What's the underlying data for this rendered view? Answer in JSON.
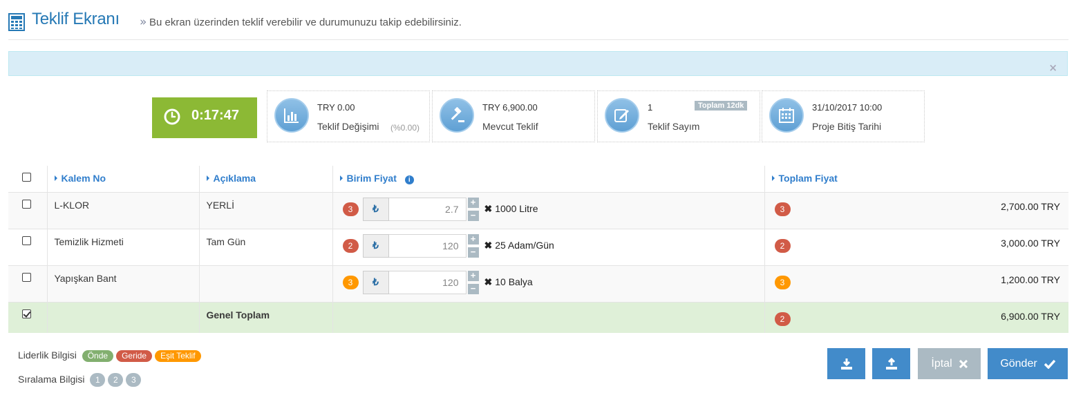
{
  "header": {
    "title": "Teklif Ekranı",
    "separator": "»",
    "subtitle": "Bu ekran üzerinden teklif verebilir ve durumunuzu takip edebilirsiniz."
  },
  "alert": {
    "close": "×"
  },
  "timer": {
    "value": "0:17:47"
  },
  "stats": [
    {
      "icon": "bar-chart-icon",
      "line1": "TRY 0.00",
      "line2": "Teklif Değişimi",
      "extra": "(%0.00)"
    },
    {
      "icon": "gavel-icon",
      "line1": "TRY 6,900.00",
      "line2": "Mevcut Teklif"
    },
    {
      "icon": "edit-icon",
      "line1": "1",
      "line2": "Teklif Sayım",
      "tag": "Toplam 12dk"
    },
    {
      "icon": "calendar-icon",
      "line1": "31/10/2017 10:00",
      "line2": "Proje Bitiş Tarihi"
    }
  ],
  "table": {
    "headers": {
      "item_no": "Kalem No",
      "description": "Açıklama",
      "unit_price": "Birim Fiyat",
      "total_price": "Toplam Fiyat"
    },
    "rows": [
      {
        "item_no": "L-KLOR",
        "description": "YERLİ",
        "rank": "3",
        "rank_color": "#d15b47",
        "currency": "₺",
        "price": "2.7",
        "unit_mult": "✖",
        "unit": "1000 Litre",
        "total_rank": "3",
        "total_rank_color": "#d15b47",
        "total": "2,700.00 TRY",
        "checked": false
      },
      {
        "item_no": "Temizlik Hizmeti",
        "description": "Tam Gün",
        "rank": "2",
        "rank_color": "#d15b47",
        "currency": "₺",
        "price": "120",
        "unit_mult": "✖",
        "unit": "25 Adam/Gün",
        "total_rank": "2",
        "total_rank_color": "#d15b47",
        "total": "3,000.00 TRY",
        "checked": false
      },
      {
        "item_no": "Yapışkan Bant",
        "description": "",
        "rank": "3",
        "rank_color": "#ff9800",
        "currency": "₺",
        "price": "120",
        "unit_mult": "✖",
        "unit": "10 Balya",
        "total_rank": "3",
        "total_rank_color": "#ff9800",
        "total": "1,200.00 TRY",
        "checked": false
      }
    ],
    "grand_total": {
      "label": "Genel Toplam",
      "rank": "2",
      "rank_color": "#d15b47",
      "total": "6,900.00 TRY",
      "checked": true
    }
  },
  "legend": {
    "leadership_label": "Liderlik Bilgisi",
    "leadership": [
      {
        "text": "Önde",
        "color": "#82af6f"
      },
      {
        "text": "Geride",
        "color": "#d15b47"
      },
      {
        "text": "Eşit Teklif",
        "color": "#ff9800"
      }
    ],
    "ranking_label": "Sıralama Bilgisi",
    "ranking": [
      "1",
      "2",
      "3"
    ]
  },
  "buttons": {
    "download": "download-icon",
    "upload": "upload-icon",
    "cancel": "İptal",
    "send": "Gönder"
  },
  "colors": {
    "title_blue": "#2679b5",
    "header_link": "#307ecc",
    "timer_green": "#8cb935",
    "button_blue": "#428bca",
    "button_gray": "#abbac3",
    "total_row_bg": "#dff0d8"
  }
}
